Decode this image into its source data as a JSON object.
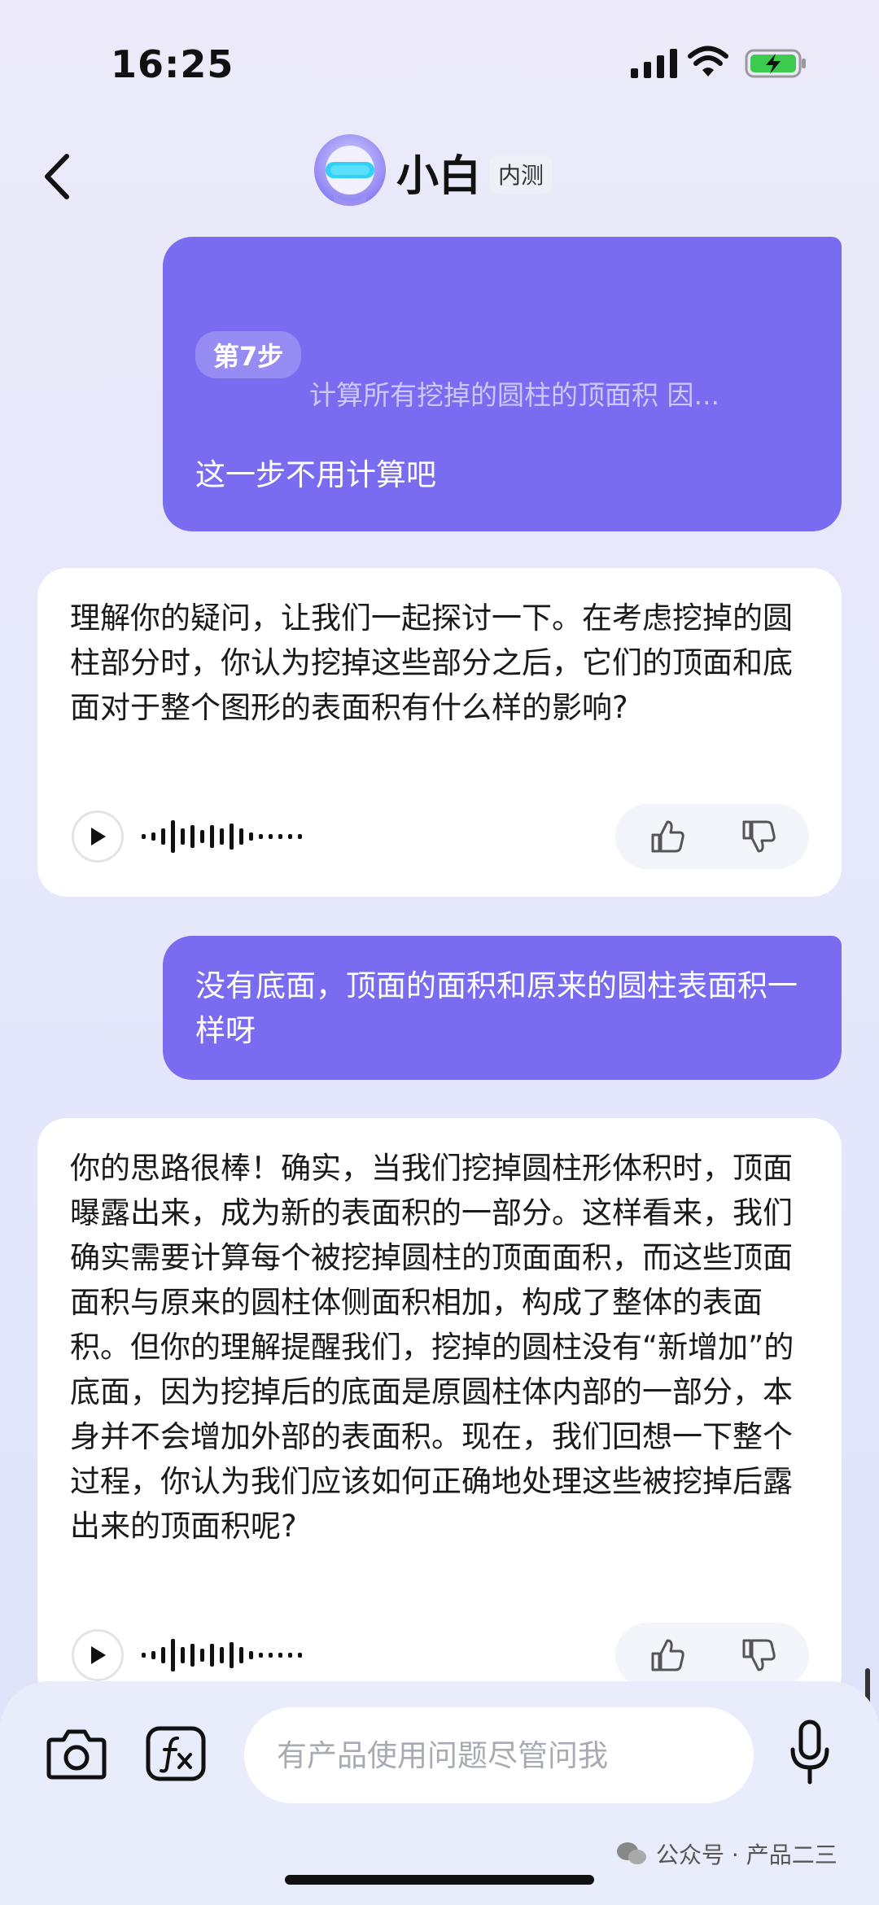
{
  "status_bar": {
    "time": "16:25"
  },
  "header": {
    "title": "小白",
    "badge": "内测"
  },
  "messages": {
    "m1": {
      "step_label": "第7步",
      "step_description": "计算所有挖掉的圆柱的顶面积 因...",
      "text": "这一步不用计算吧"
    },
    "m2": {
      "text": "理解你的疑问，让我们一起探讨一下。在考虑挖掉的圆柱部分时，你认为挖掉这些部分之后，它们的顶面和底面对于整个图形的表面积有什么样的影响?"
    },
    "m3": {
      "text": "没有底面，顶面的面积和原来的圆柱表面积一样呀"
    },
    "m4": {
      "text": "你的思路很棒！确实，当我们挖掉圆柱形体积时，顶面曝露出来，成为新的表面积的一部分。这样看来，我们确实需要计算每个被挖掉圆柱的顶面面积，而这些顶面面积与原来的圆柱体侧面积相加，构成了整体的表面积。但你的理解提醒我们，挖掉的圆柱没有“新增加”的底面，因为挖掉后的底面是原圆柱体内部的一部分，本身并不会增加外部的表面积。现在，我们回想一下整个过程，你认为我们应该如何正确地处理这些被挖掉后露出来的顶面积呢?"
    }
  },
  "input": {
    "placeholder": "有产品使用问题尽管问我"
  },
  "watermark": {
    "text": "公众号 · 产品二三"
  },
  "colors": {
    "user_bubble": "#7a6cf0",
    "ai_bubble": "#ffffff",
    "accent_battery": "#3ccb4f"
  },
  "icons": [
    "back-arrow-icon",
    "play-icon",
    "waveform-icon",
    "thumbs-up-icon",
    "thumbs-down-icon",
    "camera-icon",
    "fx-icon",
    "microphone-icon",
    "wechat-icon"
  ]
}
